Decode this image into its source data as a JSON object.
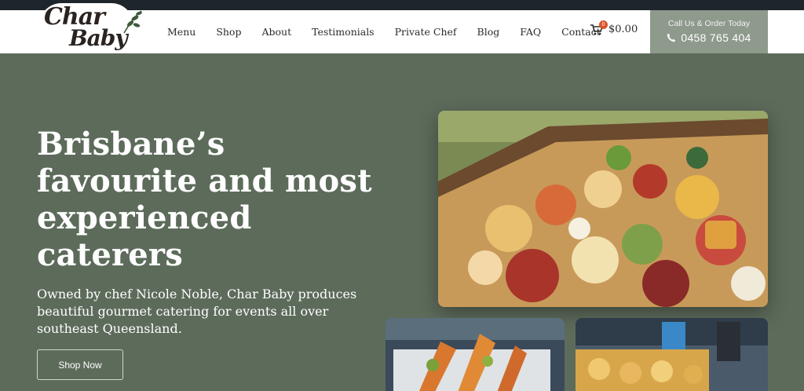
{
  "brand": {
    "logo_line1": "Char",
    "logo_line2": "Baby"
  },
  "nav": {
    "items": [
      {
        "label": "Menu"
      },
      {
        "label": "Shop"
      },
      {
        "label": "About"
      },
      {
        "label": "Testimonials"
      },
      {
        "label": "Private Chef"
      },
      {
        "label": "Blog"
      },
      {
        "label": "FAQ"
      },
      {
        "label": "Contact"
      }
    ]
  },
  "cart": {
    "count": "0",
    "total": "$0.00",
    "icon": "cart-icon"
  },
  "call": {
    "caption": "Call Us & Order Today",
    "phone": "0458 765 404",
    "icon": "phone-icon"
  },
  "hero": {
    "title": "Brisbane’s favourite and most experienced caterers",
    "subtitle": "Owned by chef Nicole Noble, Char Baby produces beautiful gourmet catering for events all over southeast Queensland.",
    "cta": "Shop Now"
  },
  "colors": {
    "hero_bg": "#5d6b5b",
    "top_strip": "#1e252b",
    "call_box": "#8e9a8c",
    "cart_badge": "#d9552b"
  }
}
